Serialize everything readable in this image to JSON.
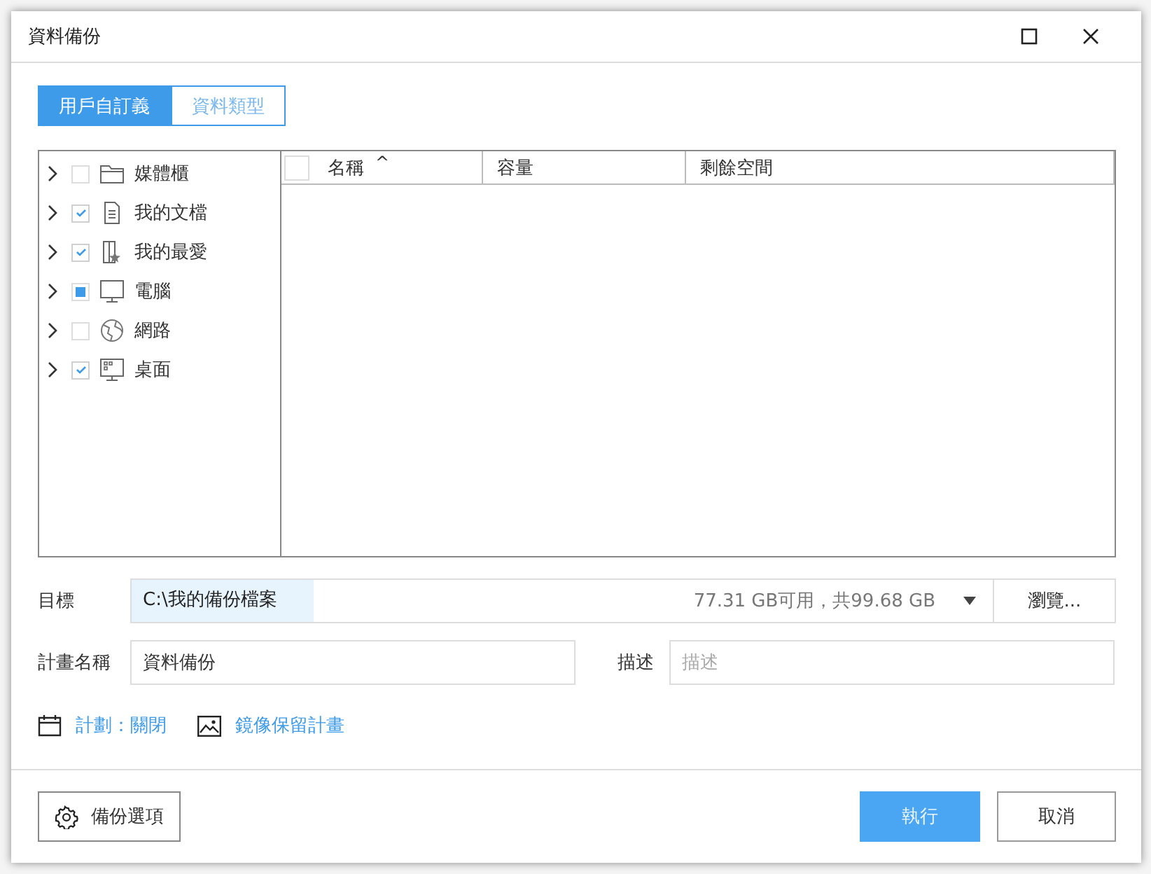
{
  "window": {
    "title": "資料備份"
  },
  "tabs": [
    {
      "label": "用戶自訂義",
      "selected": true
    },
    {
      "label": "資料類型",
      "selected": false
    }
  ],
  "tree": [
    {
      "label": "媒體櫃",
      "kind": "folder",
      "checked": false,
      "partial": false
    },
    {
      "label": "我的文檔",
      "kind": "document",
      "checked": true,
      "partial": false
    },
    {
      "label": "我的最愛",
      "kind": "favorites",
      "checked": true,
      "partial": false
    },
    {
      "label": "電腦",
      "kind": "computer",
      "checked": false,
      "partial": true
    },
    {
      "label": "網路",
      "kind": "network",
      "checked": false,
      "partial": false
    },
    {
      "label": "桌面",
      "kind": "desktop",
      "checked": true,
      "partial": false
    }
  ],
  "table": {
    "all_checked": false,
    "columns": [
      "名稱",
      "容量",
      "剩餘空間"
    ],
    "sort_mark": "^"
  },
  "target": {
    "label": "目標",
    "value": "C:\\我的備份檔案",
    "space": "77.31 GB可用，共99.68 GB",
    "browse": "瀏覽..."
  },
  "plan_name": {
    "label": "計畫名稱",
    "value": "資料備份"
  },
  "description": {
    "label": "描述",
    "placeholder": "描述"
  },
  "links": [
    {
      "label": "計劃：關閉",
      "kind": "calendar"
    },
    {
      "label": "鏡像保留計畫",
      "kind": "image"
    }
  ],
  "buttons": {
    "options": "備份選項",
    "run": "執行",
    "cancel": "取消"
  }
}
